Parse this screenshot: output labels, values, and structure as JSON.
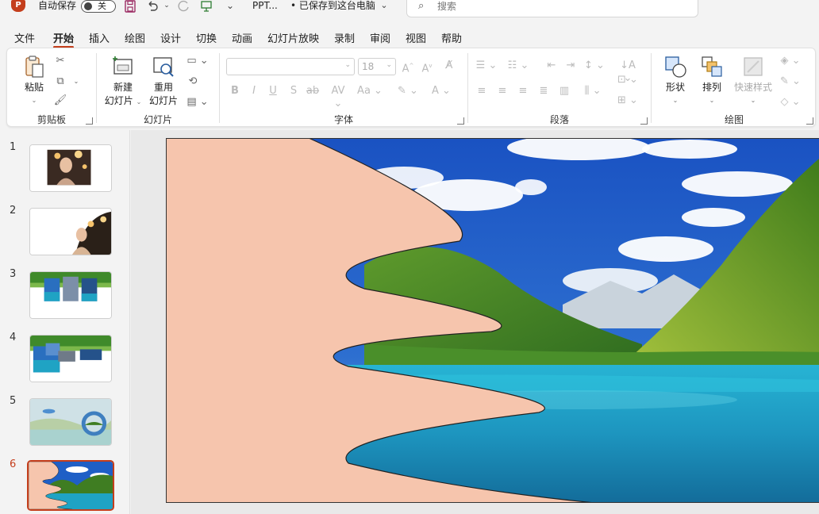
{
  "titlebar": {
    "app_logo": "P",
    "autosave_label": "自动保存",
    "autosave_state": "关",
    "doc_name": "PPT...",
    "save_status": "• 已保存到这台电脑",
    "search_placeholder": "搜索",
    "icons": [
      "save-icon",
      "undo-icon",
      "redo-icon",
      "present-icon",
      "customize-icon"
    ]
  },
  "menu": {
    "tabs": [
      "文件",
      "开始",
      "插入",
      "绘图",
      "设计",
      "切换",
      "动画",
      "幻灯片放映",
      "录制",
      "审阅",
      "视图",
      "帮助"
    ],
    "active": "开始"
  },
  "ribbon": {
    "clipboard": {
      "label": "剪贴板",
      "paste": "粘贴"
    },
    "slides": {
      "label": "幻灯片",
      "new_slide_1": "新建",
      "new_slide_2": "幻灯片",
      "reuse_1": "重用",
      "reuse_2": "幻灯片"
    },
    "font": {
      "label": "字体",
      "font_name": "",
      "font_size": "18"
    },
    "paragraph": {
      "label": "段落"
    },
    "drawing": {
      "label": "绘图",
      "shapes": "形状",
      "arrange": "排列",
      "quick_styles": "快速样式"
    }
  },
  "thumbnails": {
    "numbers": [
      "1",
      "2",
      "3",
      "4",
      "5",
      "6"
    ],
    "active_index": 6
  },
  "colors": {
    "accent": "#c43e1c",
    "shape_fill": "#f6c5ad",
    "sky": "#1f5fc6",
    "lake": "#1fa3c4",
    "forest": "#3f7d22"
  }
}
